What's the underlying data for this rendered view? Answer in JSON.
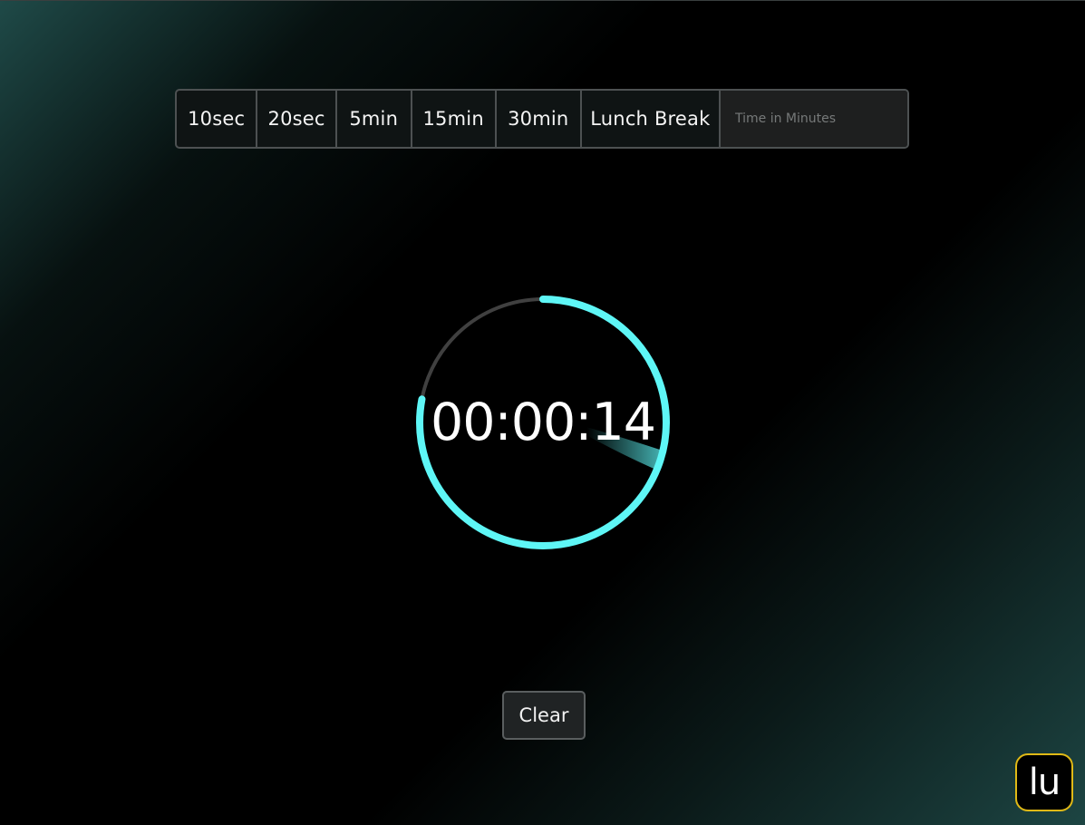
{
  "presets": [
    {
      "label": "10sec"
    },
    {
      "label": "20sec"
    },
    {
      "label": "5min"
    },
    {
      "label": "15min"
    },
    {
      "label": "30min"
    },
    {
      "label": "Lunch Break"
    }
  ],
  "custom_input": {
    "placeholder": "Time in Minutes",
    "value": ""
  },
  "timer": {
    "display": "00:00:14",
    "progress_fraction": 0.78,
    "ring_color": "#5ef6f6",
    "track_color": "#404040"
  },
  "clear_button": {
    "label": "Clear"
  },
  "logo": {
    "text": "lu",
    "border_color": "#e0b916"
  }
}
